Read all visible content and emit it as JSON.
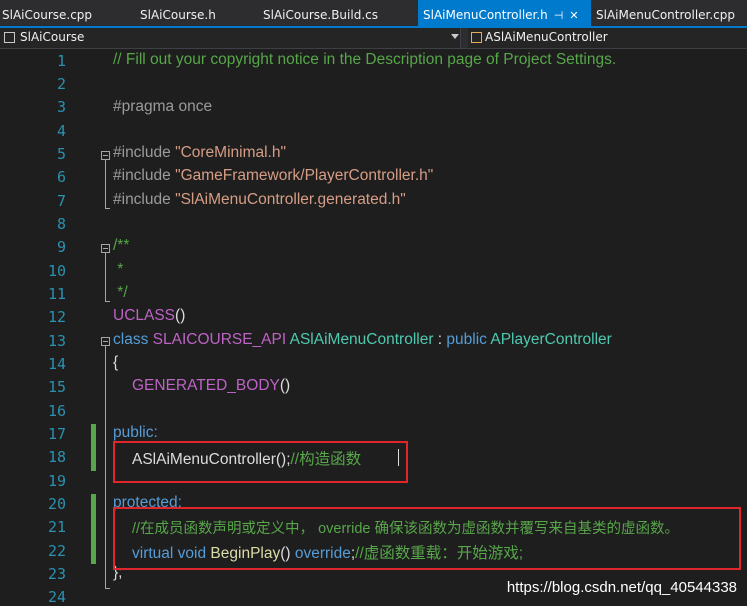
{
  "tabs": [
    {
      "label": "SlAiCourse.cpp"
    },
    {
      "label": "SlAiCourse.h"
    },
    {
      "label": "SlAiCourse.Build.cs"
    },
    {
      "label": "SlAiMenuController.h",
      "active": true
    },
    {
      "label": "SlAiMenuController.cpp"
    }
  ],
  "tab_icons": {
    "pin": "pin-icon",
    "close": "close-icon"
  },
  "navbar": {
    "project": "SlAiCourse",
    "scope": "ASlAiMenuController"
  },
  "code": {
    "line_numbers": [
      "1",
      "2",
      "3",
      "4",
      "5",
      "6",
      "7",
      "8",
      "9",
      "10",
      "11",
      "12",
      "13",
      "14",
      "15",
      "16",
      "17",
      "18",
      "19",
      "20",
      "21",
      "22",
      "23",
      "24"
    ],
    "copyright_comment": "// Fill out your copyright notice in the Description page of Project Settings.",
    "pragma": "#pragma once",
    "include_kw": "#include",
    "include1": "\"CoreMinimal.h\"",
    "include2": "\"GameFramework/PlayerController.h\"",
    "include3": "\"SlAiMenuController.generated.h\"",
    "doc_open": "/**",
    "doc_star": " *",
    "doc_close": " */",
    "uclass_macro": "UCLASS",
    "uclass_parens": "()",
    "class_kw": "class",
    "api_macro": "SLAICOURSE_API",
    "class_name": "ASlAiMenuController",
    "colon": " : ",
    "public_kw": "public",
    "base_class": "APlayerController",
    "brace_open": "{",
    "generated_body": "GENERATED_BODY",
    "generated_parens": "()",
    "public_label": "public:",
    "ctor": "ASlAiMenuController();",
    "ctor_comment": "//构造函数",
    "protected_label": "protected:",
    "override_comment": "//在成员函数声明或定义中， override 确保该函数为虚函数并覆写来自基类的虚函数。",
    "virtual_kw": "virtual",
    "void_kw": "void",
    "beginplay": "BeginPlay",
    "beginplay_parens": "() ",
    "override_kw": "override",
    "semicolon": ";",
    "beginplay_comment": "//虚函数重载：开始游戏;",
    "brace_close": "};"
  },
  "colors": {
    "accent": "#007acc",
    "comment": "#57a64a",
    "keyword": "#569cd6",
    "type": "#4ec9b0",
    "macro": "#bd63c5",
    "string": "#d69d85",
    "line_number": "#2b91af",
    "highlight_box": "#e0262b"
  },
  "watermark": "https://blog.csdn.net/qq_40544338"
}
